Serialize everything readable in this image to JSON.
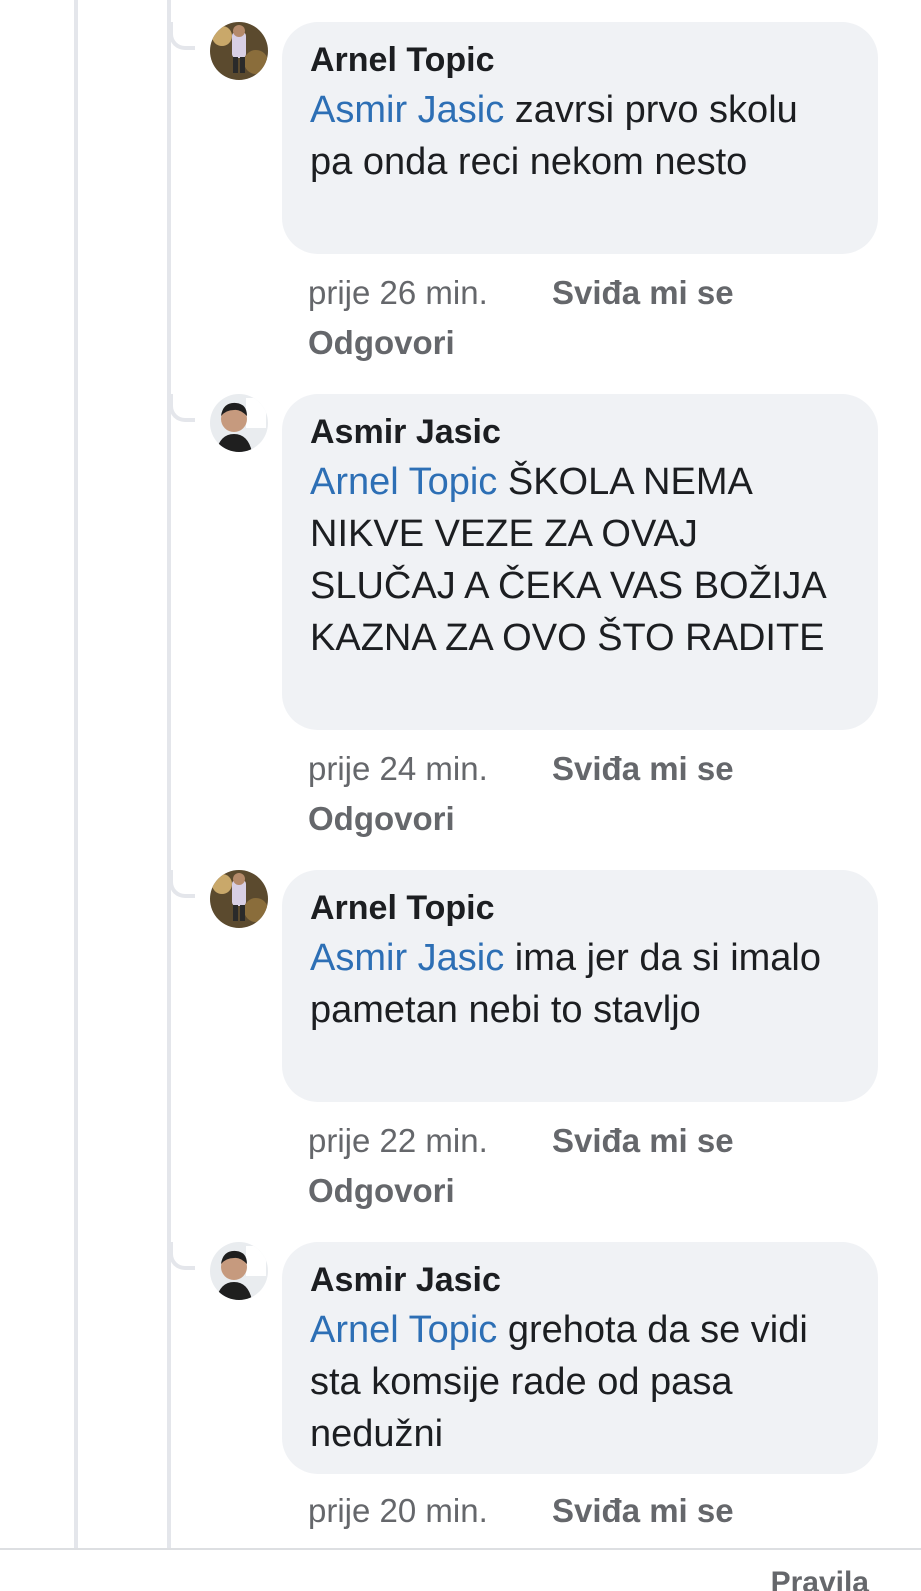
{
  "comments": [
    {
      "author": "Arnel Topic",
      "mention": "Asmir Jasic",
      "text": " zavrsi prvo skolu pa onda reci nekom nesto",
      "time": "prije 26 min.",
      "like_label": "Sviđa mi se",
      "reply_label": "Odgovori"
    },
    {
      "author": "Asmir Jasic",
      "mention": "Arnel Topic",
      "text": " ŠKOLA NEMA NIKVE VEZE ZA OVAJ SLUČAJ A ČEKA VAS BOŽIJA KAZNA ZA OVO ŠTO RADITE",
      "time": "prije 24 min.",
      "like_label": "Sviđa mi se",
      "reply_label": "Odgovori"
    },
    {
      "author": "Arnel Topic",
      "mention": "Asmir Jasic",
      "text": " ima jer da si imalo pametan nebi to stavljo",
      "time": "prije 22 min.",
      "like_label": "Sviđa mi se",
      "reply_label": "Odgovori"
    },
    {
      "author": "Asmir Jasic",
      "mention": "Arnel Topic",
      "text": " grehota da se vidi sta komsije rade od pasa nedužni",
      "time": "prije 20 min.",
      "like_label": "Sviđa mi se"
    }
  ],
  "footer": {
    "rules_label": "Pravila"
  },
  "colors": {
    "mention": "#2d6fb5",
    "bubble": "#f0f2f5",
    "meta": "#65676b"
  }
}
